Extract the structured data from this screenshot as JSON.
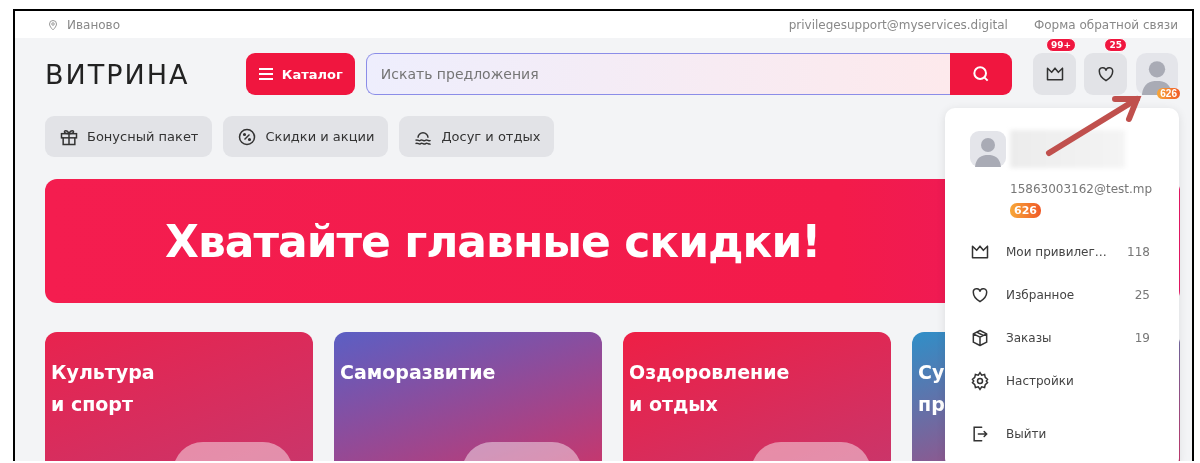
{
  "topbar": {
    "city": "Иваново",
    "email": "privilegesupport@myservices.digital",
    "feedback": "Форма обратной связи"
  },
  "header": {
    "logo": "ВИТРИНА",
    "catalog_label": "Каталог",
    "search_placeholder": "Искать предложения",
    "icon_buttons": [
      {
        "kind": "crown",
        "badge": "99+"
      },
      {
        "kind": "heart",
        "badge": "25"
      }
    ],
    "profile_badge": "626"
  },
  "chips": [
    {
      "kind": "gift",
      "label": "Бонусный пакет"
    },
    {
      "kind": "percent",
      "label": "Скидки и акции"
    },
    {
      "kind": "waves",
      "label": "Досуг и отдых"
    }
  ],
  "banner": {
    "title": "Хватайте главные скидки!"
  },
  "cards": [
    {
      "title_lines": [
        "Культура",
        "и спорт"
      ],
      "color": "#e8234e"
    },
    {
      "title_lines": [
        "Саморазвитие"
      ],
      "color": "#5b5fc4"
    },
    {
      "title_lines": [
        "Оздоровление",
        "и отдых"
      ],
      "color": "#ee1f45"
    },
    {
      "title_lines": [
        "Су",
        "пр"
      ],
      "color": "#2f8fc8"
    }
  ],
  "profile_menu": {
    "email": "15863003162@test.mp",
    "points": "626",
    "items": [
      {
        "kind": "crown",
        "label": "Мои привилег…",
        "count": "118"
      },
      {
        "kind": "heart",
        "label": "Избранное",
        "count": "25"
      },
      {
        "kind": "box",
        "label": "Заказы",
        "count": "19"
      },
      {
        "kind": "gear",
        "label": "Настройки"
      },
      {
        "kind": "exit",
        "label": "Выйти"
      }
    ]
  }
}
